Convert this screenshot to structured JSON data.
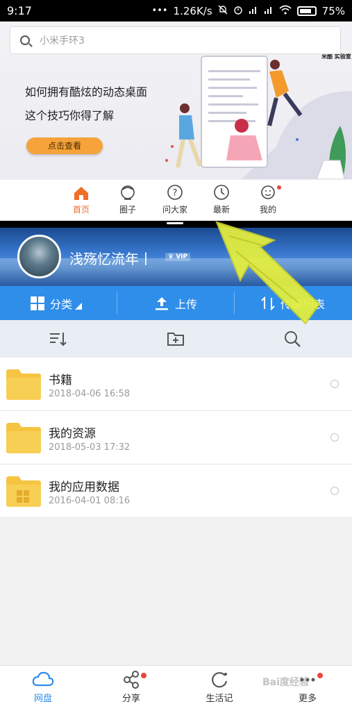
{
  "status_bar": {
    "time": "9:17",
    "dots": "•••",
    "speed": "1.26K/s",
    "battery": "75%"
  },
  "top_app": {
    "search_placeholder": "小米手环3",
    "banner": {
      "line1": "如何拥有酷炫的动态桌面",
      "line2": "这个技巧你得了解",
      "cta": "点击查看",
      "brand": "米酷 实验室"
    },
    "tabs": [
      {
        "label": "首页",
        "icon": "home-icon",
        "active": true
      },
      {
        "label": "圈子",
        "icon": "circle-face-icon"
      },
      {
        "label": "问大家",
        "icon": "question-icon"
      },
      {
        "label": "最新",
        "icon": "clock-icon"
      },
      {
        "label": "我的",
        "icon": "smiley-icon",
        "badge": true
      }
    ],
    "accent": "#ef6e28"
  },
  "cloud_app": {
    "profile": {
      "username": "浅殇忆流年丨",
      "vip": "VIP"
    },
    "actions": [
      {
        "label": "分类",
        "icon": "grid-icon",
        "dropdown": true
      },
      {
        "label": "上传",
        "icon": "upload-icon"
      },
      {
        "label": "传输列表",
        "icon": "transfer-icon"
      }
    ],
    "toolbar_icons": [
      "sort-icon",
      "new-folder-icon",
      "search-icon"
    ],
    "files": [
      {
        "name": "书籍",
        "date": "2018-04-06  16:58",
        "icon": "folder-icon"
      },
      {
        "name": "我的资源",
        "date": "2018-05-03  17:32",
        "icon": "folder-icon"
      },
      {
        "name": "我的应用数据",
        "date": "2016-04-01  08:16",
        "icon": "app-folder-icon"
      }
    ],
    "bottom_nav": [
      {
        "label": "网盘",
        "icon": "cloud-icon",
        "active": true
      },
      {
        "label": "分享",
        "icon": "share-icon",
        "badge": true
      },
      {
        "label": "生活记",
        "icon": "life-record-icon"
      },
      {
        "label": "更多",
        "icon": "more-icon",
        "badge": true
      }
    ],
    "accent": "#2f8ee9"
  },
  "watermark": "Bai度经验",
  "annotation_color": "#e6f03c"
}
